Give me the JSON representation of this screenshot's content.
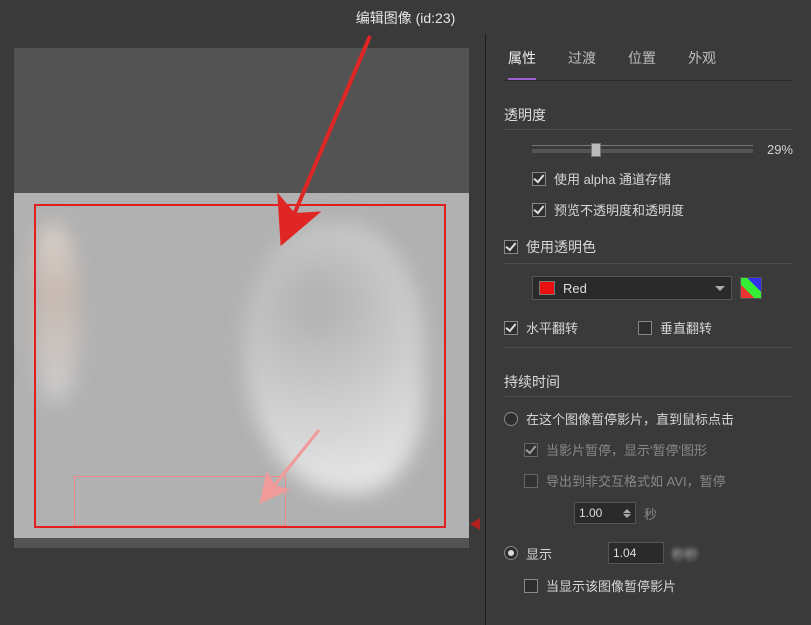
{
  "title": "编辑图像 (id:23)",
  "tabs": [
    "属性",
    "过渡",
    "位置",
    "外观"
  ],
  "active_tab_index": 0,
  "opacity": {
    "header": "透明度",
    "percent": "29%",
    "slider_value": 29,
    "alpha_checkbox_label": "使用 alpha 通道存储",
    "alpha_checked": true,
    "preview_checkbox_label": "预览不透明度和透明度",
    "preview_checked": true
  },
  "transparent_color": {
    "checkbox_label": "使用透明色",
    "checked": true,
    "dropdown_value": "Red",
    "swatch_color": "#e81010"
  },
  "flip": {
    "horizontal_label": "水平翻转",
    "horizontal_checked": true,
    "vertical_label": "垂直翻转",
    "vertical_checked": false
  },
  "duration": {
    "header": "持续时间",
    "pause_radio_label": "在这个图像暂停影片，直到鼠标点击",
    "pause_selected": false,
    "pause_sub1_label": "当影片暂停，显示'暂停'图形",
    "pause_sub1_checked": true,
    "pause_sub2_label": "导出到非交互格式如 AVI，暂停",
    "pause_sub2_checked": false,
    "pause_time_value": "1.00",
    "pause_time_unit": "秒",
    "show_radio_label": "显示",
    "show_selected": true,
    "show_value": "1.04",
    "show_suffix_blur": "秒秒",
    "show_sub_label": "当显示该图像暂停影片",
    "show_sub_checked": false
  }
}
